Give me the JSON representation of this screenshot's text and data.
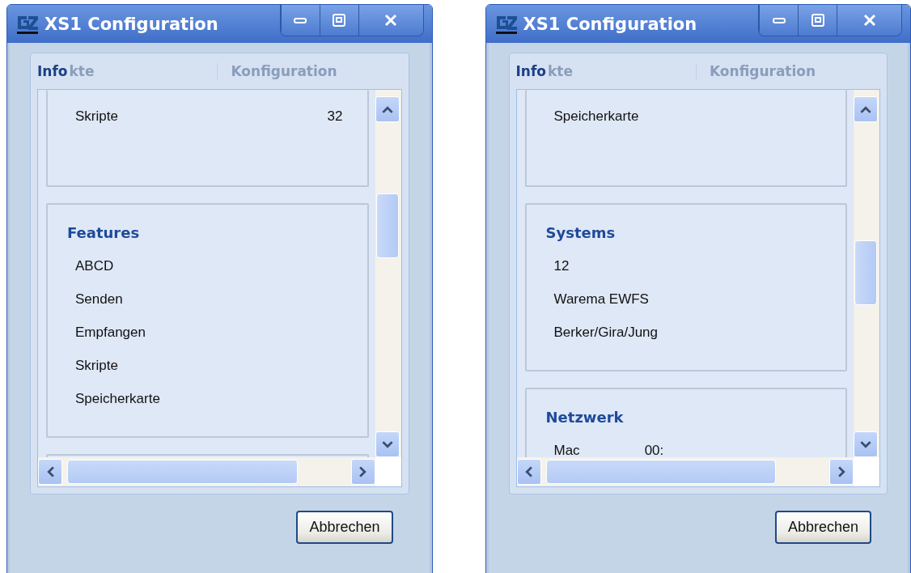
{
  "windows": [
    {
      "title": "XS1 Configuration",
      "tabs": [
        {
          "label": "kte"
        },
        {
          "label": "Konfiguration"
        }
      ],
      "panel_title": "Info",
      "groups": [
        {
          "rows": [
            {
              "label": "Skripte",
              "value": "32"
            }
          ]
        },
        {
          "title": "Features",
          "rows": [
            {
              "label": "ABCD"
            },
            {
              "label": "Senden"
            },
            {
              "label": "Empfangen"
            },
            {
              "label": "Skripte"
            },
            {
              "label": "Speicherkarte"
            }
          ]
        }
      ],
      "more_cards": true,
      "button": "Abbrechen"
    },
    {
      "title": "XS1 Configuration",
      "tabs": [
        {
          "label": "kte"
        },
        {
          "label": "Konfiguration"
        }
      ],
      "panel_title": "Info",
      "groups": [
        {
          "rows": [
            {
              "label": "Speicherkarte"
            }
          ]
        },
        {
          "title": "Systems",
          "rows": [
            {
              "label": "12"
            },
            {
              "label": "Warema EWFS"
            },
            {
              "label": "Berker/Gira/Jung"
            }
          ]
        },
        {
          "title": "Netzwerk",
          "rows": [
            {
              "label": "Mac",
              "value": "00:"
            }
          ]
        }
      ],
      "button": "Abbrechen"
    }
  ]
}
